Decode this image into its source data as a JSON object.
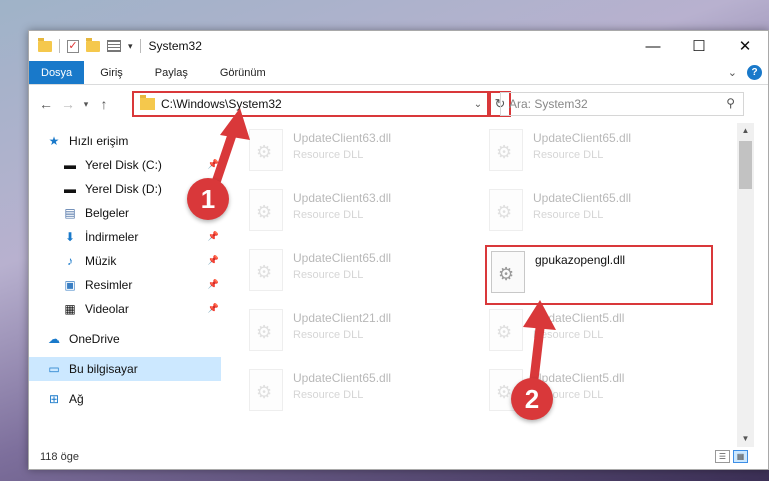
{
  "window": {
    "title": "System32"
  },
  "ribbon": {
    "tabs": [
      "Dosya",
      "Giriş",
      "Paylaş",
      "Görünüm"
    ]
  },
  "nav": {
    "address": "C:\\Windows\\System32",
    "search_placeholder": "Ara: System32"
  },
  "sidebar": {
    "items": [
      {
        "label": "Hızlı erişim",
        "icon": "star-icon",
        "pinned": false,
        "child": false
      },
      {
        "label": "Yerel Disk (C:)",
        "icon": "drive-icon",
        "pinned": true,
        "child": true
      },
      {
        "label": "Yerel Disk (D:)",
        "icon": "drive-icon",
        "pinned": true,
        "child": true
      },
      {
        "label": "Belgeler",
        "icon": "document-icon",
        "pinned": true,
        "child": true
      },
      {
        "label": "İndirmeler",
        "icon": "download-icon",
        "pinned": true,
        "child": true
      },
      {
        "label": "Müzik",
        "icon": "music-icon",
        "pinned": true,
        "child": true
      },
      {
        "label": "Resimler",
        "icon": "pictures-icon",
        "pinned": true,
        "child": true
      },
      {
        "label": "Videolar",
        "icon": "video-icon",
        "pinned": true,
        "child": true
      },
      {
        "label": "OneDrive",
        "icon": "cloud-icon",
        "pinned": false,
        "child": false
      },
      {
        "label": "Bu bilgisayar",
        "icon": "computer-icon",
        "pinned": false,
        "child": false
      },
      {
        "label": "Ağ",
        "icon": "network-icon",
        "pinned": false,
        "child": false
      }
    ]
  },
  "files": [
    {
      "name": "UpdateClient63.dll",
      "type": "Resource DLL"
    },
    {
      "name": "UpdateClient65.dll",
      "type": "Resource DLL"
    },
    {
      "name": "UpdateClient63.dll",
      "type": "Resource DLL"
    },
    {
      "name": "UpdateClient65.dll",
      "type": "Resource DLL"
    },
    {
      "name": "UpdateClient65.dll",
      "type": "Resource DLL"
    },
    {
      "name": "gpukazopengl.dll",
      "type": ""
    },
    {
      "name": "UpdateClient21.dll",
      "type": "Resource DLL"
    },
    {
      "name": "UpdateClient5.dll",
      "type": "Resource DLL"
    },
    {
      "name": "UpdateClient65.dll",
      "type": "Resource DLL"
    },
    {
      "name": "UpdateClient5.dll",
      "type": "Resource DLL"
    }
  ],
  "status": {
    "count": "118 öge"
  },
  "annotations": {
    "step1": "1",
    "step2": "2"
  },
  "colors": {
    "accent": "#1979ca",
    "highlight": "#d9383a",
    "selection": "#cce8ff"
  }
}
